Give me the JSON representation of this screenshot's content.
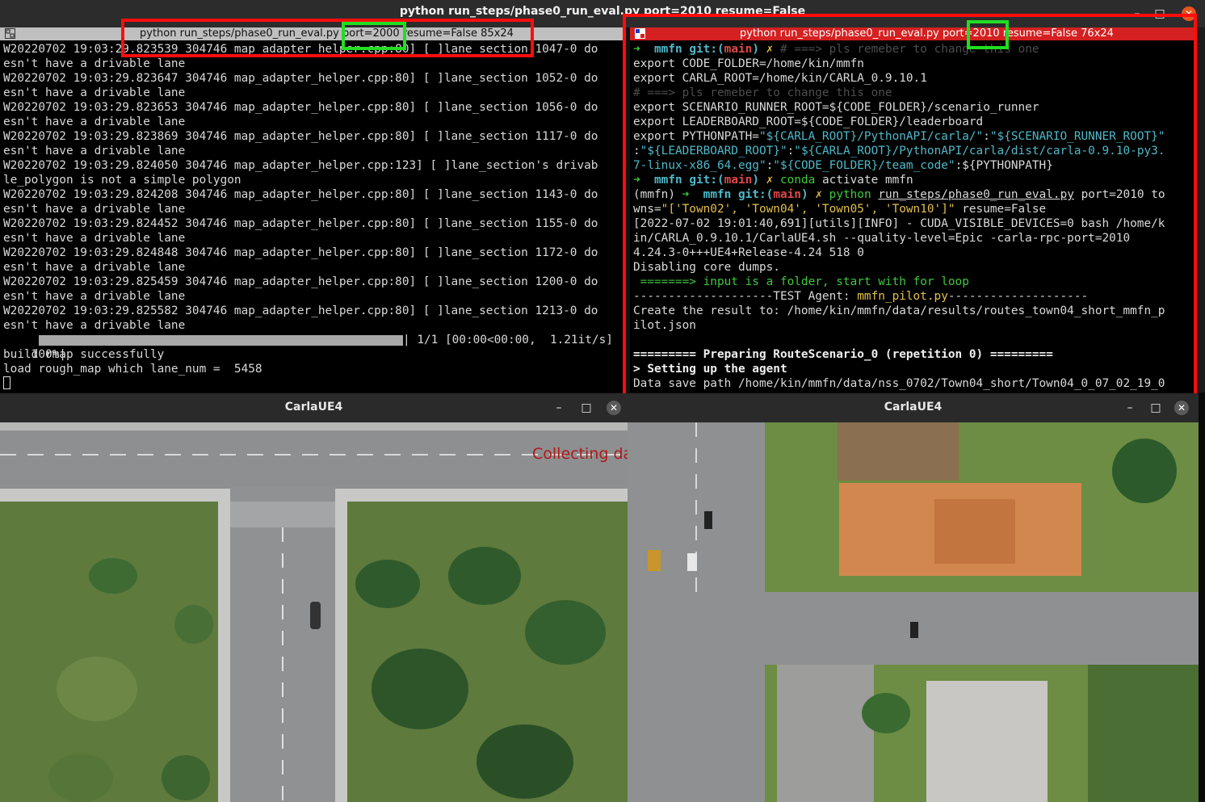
{
  "outer_window": {
    "title": "python run_steps/phase0_run_eval.py port=2010 resume=False",
    "minimize": "–",
    "maximize": "□",
    "close": "✕"
  },
  "left_terminal": {
    "title": "python run_steps/phase0_run_eval.py port=2000 resume=False 85x24",
    "lines": [
      "W20220702 19:03:29.823539 304746 map_adapter_helper.cpp:80] [ ]lane_section 1047-0 do",
      "esn't have a drivable lane",
      "W20220702 19:03:29.823647 304746 map_adapter_helper.cpp:80] [ ]lane_section 1052-0 do",
      "esn't have a drivable lane",
      "W20220702 19:03:29.823653 304746 map_adapter_helper.cpp:80] [ ]lane_section 1056-0 do",
      "esn't have a drivable lane",
      "W20220702 19:03:29.823869 304746 map_adapter_helper.cpp:80] [ ]lane_section 1117-0 do",
      "esn't have a drivable lane",
      "W20220702 19:03:29.824050 304746 map_adapter_helper.cpp:123] [ ]lane_section's drivab",
      "le_polygon is not a simple polygon",
      "W20220702 19:03:29.824208 304746 map_adapter_helper.cpp:80] [ ]lane_section 1143-0 do",
      "esn't have a drivable lane",
      "W20220702 19:03:29.824452 304746 map_adapter_helper.cpp:80] [ ]lane_section 1155-0 do",
      "esn't have a drivable lane",
      "W20220702 19:03:29.824848 304746 map_adapter_helper.cpp:80] [ ]lane_section 1172-0 do",
      "esn't have a drivable lane",
      "W20220702 19:03:29.825459 304746 map_adapter_helper.cpp:80] [ ]lane_section 1200-0 do",
      "esn't have a drivable lane",
      "W20220702 19:03:29.825582 304746 map_adapter_helper.cpp:80] [ ]lane_section 1213-0 do",
      "esn't have a drivable lane"
    ],
    "progress_pct": "100%|",
    "progress_value": 1.0,
    "progress_tail": "| 1/1 [00:00<00:00,  1.21it/s]",
    "after_lines": [
      "build rmap successfully",
      "load rough_map which lane_num =  5458"
    ]
  },
  "right_terminal": {
    "title": "python run_steps/phase0_run_eval.py port=2010 resume=False 76x24",
    "line1": {
      "arrow": "➜",
      "dir": "mmfn",
      "git": "git:(",
      "branch": "main",
      "close": ")",
      "x": "✗",
      "comment": "# ===> pls remeber to change this one"
    },
    "export_code": "export CODE_FOLDER=/home/kin/mmfn",
    "export_carla": "export CARLA_ROOT=/home/kin/CARLA_0.9.10.1",
    "comment2": "# ===> pls remeber to change this one",
    "export_sr": "export SCENARIO_RUNNER_ROOT=${CODE_FOLDER}/scenario_runner",
    "export_lb": "export LEADERBOARD_ROOT=${CODE_FOLDER}/leaderboard",
    "py1_a": "export PYTHONPATH=",
    "py1_b": "\"${CARLA_ROOT}/PythonAPI/carla/\"",
    "py1_c": ":",
    "py1_d": "\"${SCENARIO_RUNNER_ROOT}\"",
    "py2_a": ":",
    "py2_b": "\"${LEADERBOARD_ROOT}\"",
    "py2_c": ":",
    "py2_d": "\"${CARLA_ROOT}/PythonAPI/carla/dist/carla-0.9.10-py3.",
    "py3_a": "7-linux-x86_64.egg\"",
    "py3_b": ":",
    "py3_c": "\"${CODE_FOLDER}/team_code\"",
    "py3_d": ":${PYTHONPATH}",
    "conda_cmd": "conda",
    "conda_rest": " activate mmfn",
    "env": "(mmfn)",
    "python_cmd": "python",
    "script": "run_steps/phase0_run_eval.py",
    "args1": " port=2010 to",
    "args2_a": "wns=",
    "args2_b": "\"['Town02', 'Town04', 'Town05', 'Town10']\"",
    "args2_c": " resume=False",
    "log1": "[2022-07-02 19:01:40,691][utils][INFO] - CUDA_VISIBLE_DEVICES=0 bash /home/k",
    "log2": "in/CARLA_0.9.10.1/CarlaUE4.sh --quality-level=Epic -carla-rpc-port=2010",
    "log3": "4.24.3-0+++UE4+Release-4.24 518 0",
    "log4": "Disabling core dumps.",
    "loop_a": " =======> ",
    "loop_b": "input is a folder, start with for loop",
    "test_a": "--------------------TEST Agent: ",
    "test_b": "mmfn_pilot.py",
    "test_c": "--------------------",
    "result1": "Create the result to: /home/kin/mmfn/data/results/routes_town04_short_mmfn_p",
    "result2": "ilot.json",
    "blank": "",
    "prep": "========= Preparing RouteScenario_0 (repetition 0) =========",
    "setup": "> Setting up the agent",
    "save": "Data save path /home/kin/mmfn/data/nss_0702/Town04_short/Town04_0_07_02_19_0"
  },
  "left_game": {
    "title": "CarlaUE4",
    "minimize": "–",
    "maximize": "□",
    "close": "✕",
    "overlay": "Collecting data now"
  },
  "right_game": {
    "title": "CarlaUE4",
    "minimize": "–",
    "maximize": "□",
    "close": "✕"
  },
  "colors": {
    "highlight_red": "#ff0d0d",
    "highlight_green": "#22dd22",
    "prompt_green": "#3ec83e",
    "cyan": "#4fb9c9",
    "branch_red": "#e04848",
    "overlay_red": "#b01818",
    "right_tab_red": "#d42020"
  }
}
